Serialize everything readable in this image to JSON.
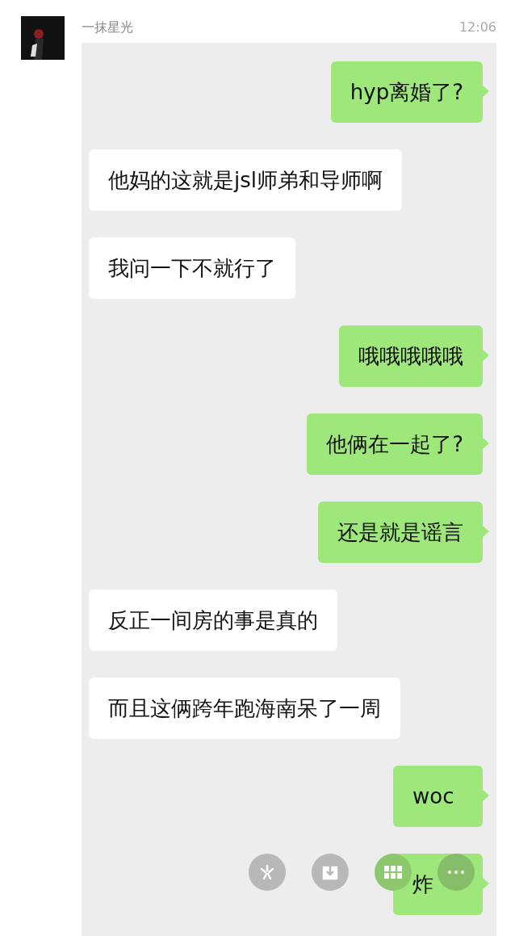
{
  "contact": {
    "name": "一抹星光",
    "time": "12:06"
  },
  "messages": [
    {
      "kind": "sent",
      "text": "hyp离婚了?"
    },
    {
      "kind": "received",
      "text": "他妈的这就是jsl师弟和导师啊"
    },
    {
      "kind": "received",
      "text": "我问一下不就行了"
    },
    {
      "kind": "sent",
      "text": "哦哦哦哦哦"
    },
    {
      "kind": "sent",
      "text": "他俩在一起了?"
    },
    {
      "kind": "sent",
      "text": "还是就是谣言"
    },
    {
      "kind": "received",
      "text": "反正一间房的事是真的"
    },
    {
      "kind": "received",
      "text": "而且这俩跨年跑海南呆了一周"
    },
    {
      "kind": "sent",
      "text": "woc"
    },
    {
      "kind": "sent",
      "text": "炸"
    }
  ]
}
